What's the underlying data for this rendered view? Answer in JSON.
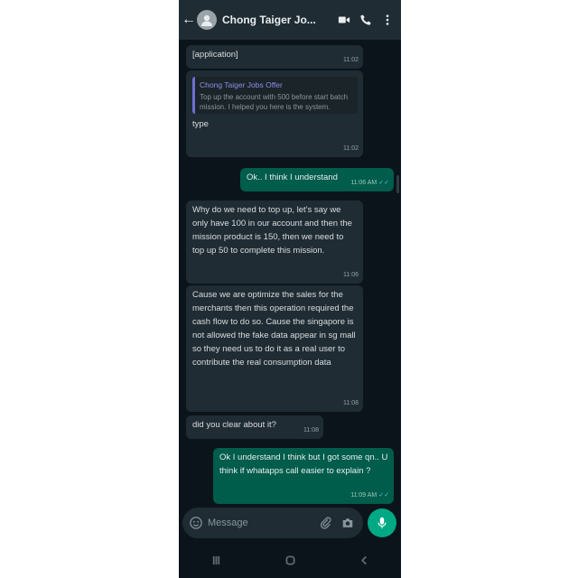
{
  "header": {
    "contact_name": "Chong Taiger Jo..."
  },
  "messages": [
    {
      "text": "[application]",
      "time": "11:02"
    },
    {
      "quote_name": "Chong Taiger Jobs Offer",
      "quote_text": "Top up the account with 500 before start batch mission. I helped you here is the system.",
      "text": "type",
      "time": "11:02"
    },
    {
      "text": "Ok.. I think I understand",
      "time": "11:06 AM"
    },
    {
      "text": "Why do we need to top up, let's say we only have 100 in our account and then the mission product is 150, then we need to top up 50 to complete this mission.",
      "time": "11:06"
    },
    {
      "text": "Cause we are optimize the sales for the merchants then this operation required the cash flow to do so. Cause the singapore is not allowed the fake data appear in sg mall so they need us to do it as a real user to contribute the real consumption data",
      "time": "11:08"
    },
    {
      "text": "did you clear about it?",
      "time": "11:08"
    },
    {
      "text": "Ok I understand I think but I got some qn.. U think if whatapps call easier to explain ?",
      "time": "11:09 AM"
    }
  ],
  "input": {
    "placeholder": "Message"
  },
  "colors": {
    "incoming": "#202c33",
    "outgoing": "#005c4b",
    "accent": "#00a884"
  }
}
